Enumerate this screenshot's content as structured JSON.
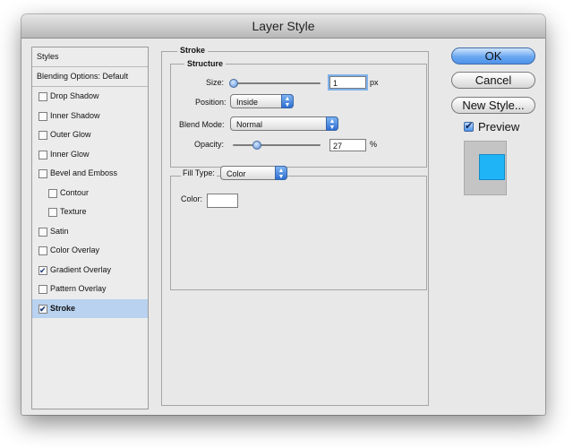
{
  "window": {
    "title": "Layer Style"
  },
  "styles": {
    "header": "Styles",
    "blending": "Blending Options: Default",
    "items": [
      {
        "label": "Drop Shadow",
        "checked": false,
        "sub": false,
        "selected": false
      },
      {
        "label": "Inner Shadow",
        "checked": false,
        "sub": false,
        "selected": false
      },
      {
        "label": "Outer Glow",
        "checked": false,
        "sub": false,
        "selected": false
      },
      {
        "label": "Inner Glow",
        "checked": false,
        "sub": false,
        "selected": false
      },
      {
        "label": "Bevel and Emboss",
        "checked": false,
        "sub": false,
        "selected": false
      },
      {
        "label": "Contour",
        "checked": false,
        "sub": true,
        "selected": false
      },
      {
        "label": "Texture",
        "checked": false,
        "sub": true,
        "selected": false
      },
      {
        "label": "Satin",
        "checked": false,
        "sub": false,
        "selected": false
      },
      {
        "label": "Color Overlay",
        "checked": false,
        "sub": false,
        "selected": false
      },
      {
        "label": "Gradient Overlay",
        "checked": true,
        "sub": false,
        "selected": false
      },
      {
        "label": "Pattern Overlay",
        "checked": false,
        "sub": false,
        "selected": false
      },
      {
        "label": "Stroke",
        "checked": true,
        "sub": false,
        "selected": true
      }
    ]
  },
  "stroke": {
    "title": "Stroke",
    "structure_title": "Structure",
    "size_label": "Size:",
    "size_value": "1",
    "size_unit": "px",
    "position_label": "Position:",
    "position_value": "Inside",
    "blend_label": "Blend Mode:",
    "blend_value": "Normal",
    "opacity_label": "Opacity:",
    "opacity_value": "27",
    "opacity_unit": "%",
    "size_slider_fraction": 0.0,
    "opacity_slider_fraction": 0.27,
    "fill_type_label": "Fill Type:",
    "fill_type_value": "Color",
    "color_label": "Color:",
    "color_value": "#ffffff"
  },
  "buttons": {
    "ok": "OK",
    "cancel": "Cancel",
    "new_style": "New Style...",
    "preview": "Preview",
    "preview_checked": true
  },
  "colors": {
    "selected_row": "#b8d2f0",
    "accent_blue": "#4f93ea",
    "preview_swatch": "#1fb4f6"
  }
}
